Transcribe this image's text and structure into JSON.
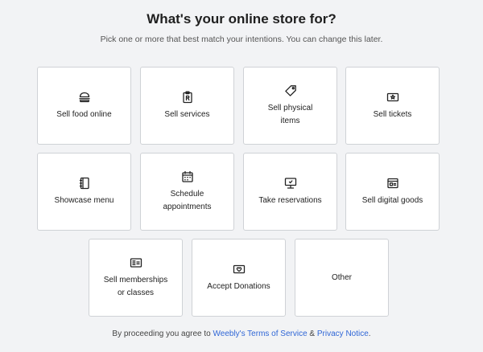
{
  "header": {
    "title": "What's your online store for?",
    "subtitle": "Pick one or more that best match your intentions. You can change this later."
  },
  "options": [
    {
      "label": "Sell food online",
      "icon": "burger-icon"
    },
    {
      "label": "Sell services",
      "icon": "clipboard-icon"
    },
    {
      "label": "Sell physical\nitems",
      "icon": "tag-icon"
    },
    {
      "label": "Sell tickets",
      "icon": "ticket-icon"
    },
    {
      "label": "Showcase menu",
      "icon": "notebook-icon"
    },
    {
      "label": "Schedule\nappointments",
      "icon": "calendar-icon"
    },
    {
      "label": "Take reservations",
      "icon": "reservation-icon"
    },
    {
      "label": "Sell digital goods",
      "icon": "digital-goods-icon"
    },
    {
      "label": "Sell memberships\nor classes",
      "icon": "membership-card-icon"
    },
    {
      "label": "Accept Donations",
      "icon": "donation-icon"
    },
    {
      "label": "Other",
      "icon": ""
    }
  ],
  "footer": {
    "prefix": "By proceeding you agree to ",
    "terms_link": "Weebly's Terms of Service",
    "joiner": " & ",
    "privacy_link": "Privacy Notice",
    "suffix": "."
  }
}
